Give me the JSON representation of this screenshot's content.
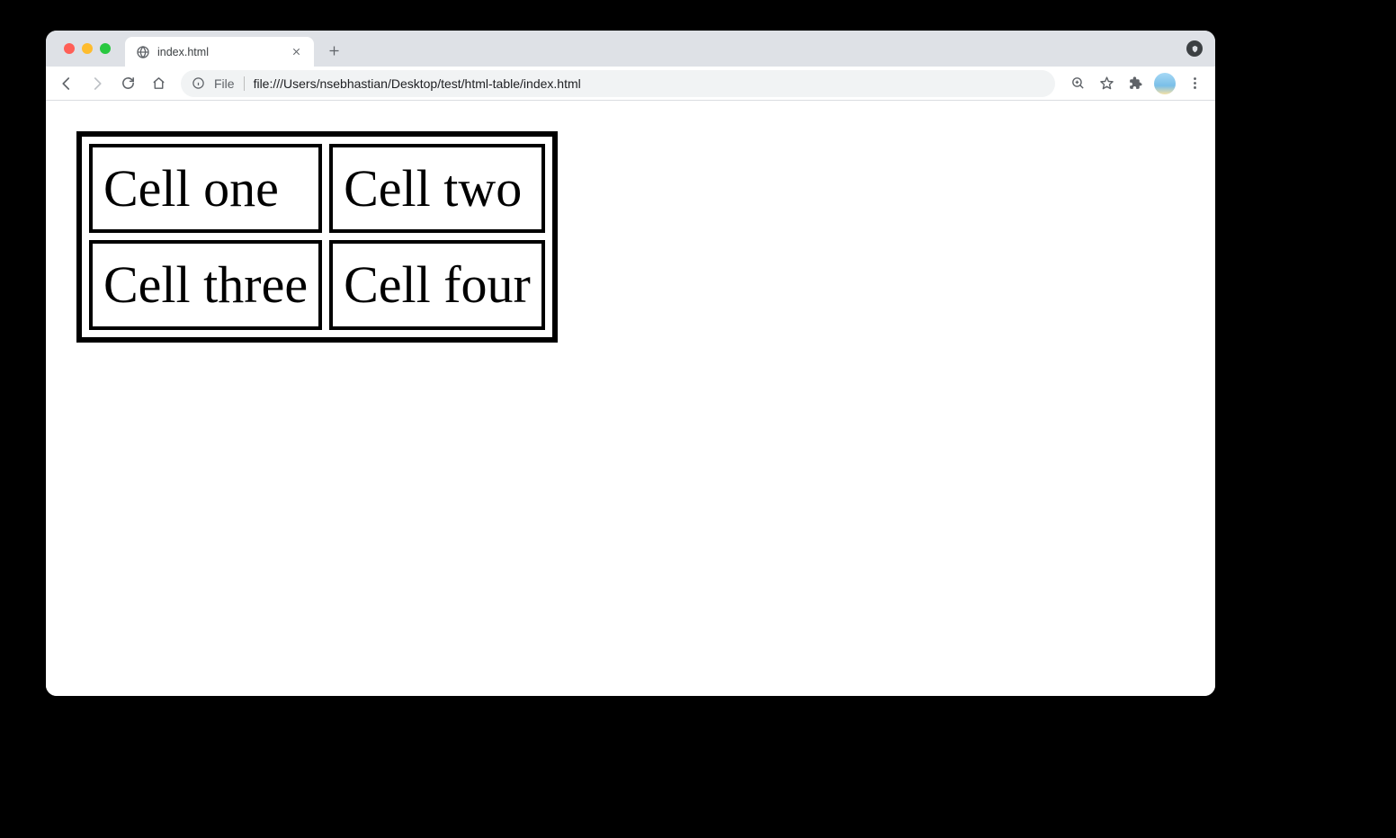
{
  "tab": {
    "title": "index.html"
  },
  "addressbar": {
    "origin_label": "File",
    "url": "file:///Users/nsebhastian/Desktop/test/html-table/index.html"
  },
  "page": {
    "table": {
      "rows": [
        [
          "Cell one",
          "Cell two"
        ],
        [
          "Cell three",
          "Cell four"
        ]
      ]
    }
  }
}
